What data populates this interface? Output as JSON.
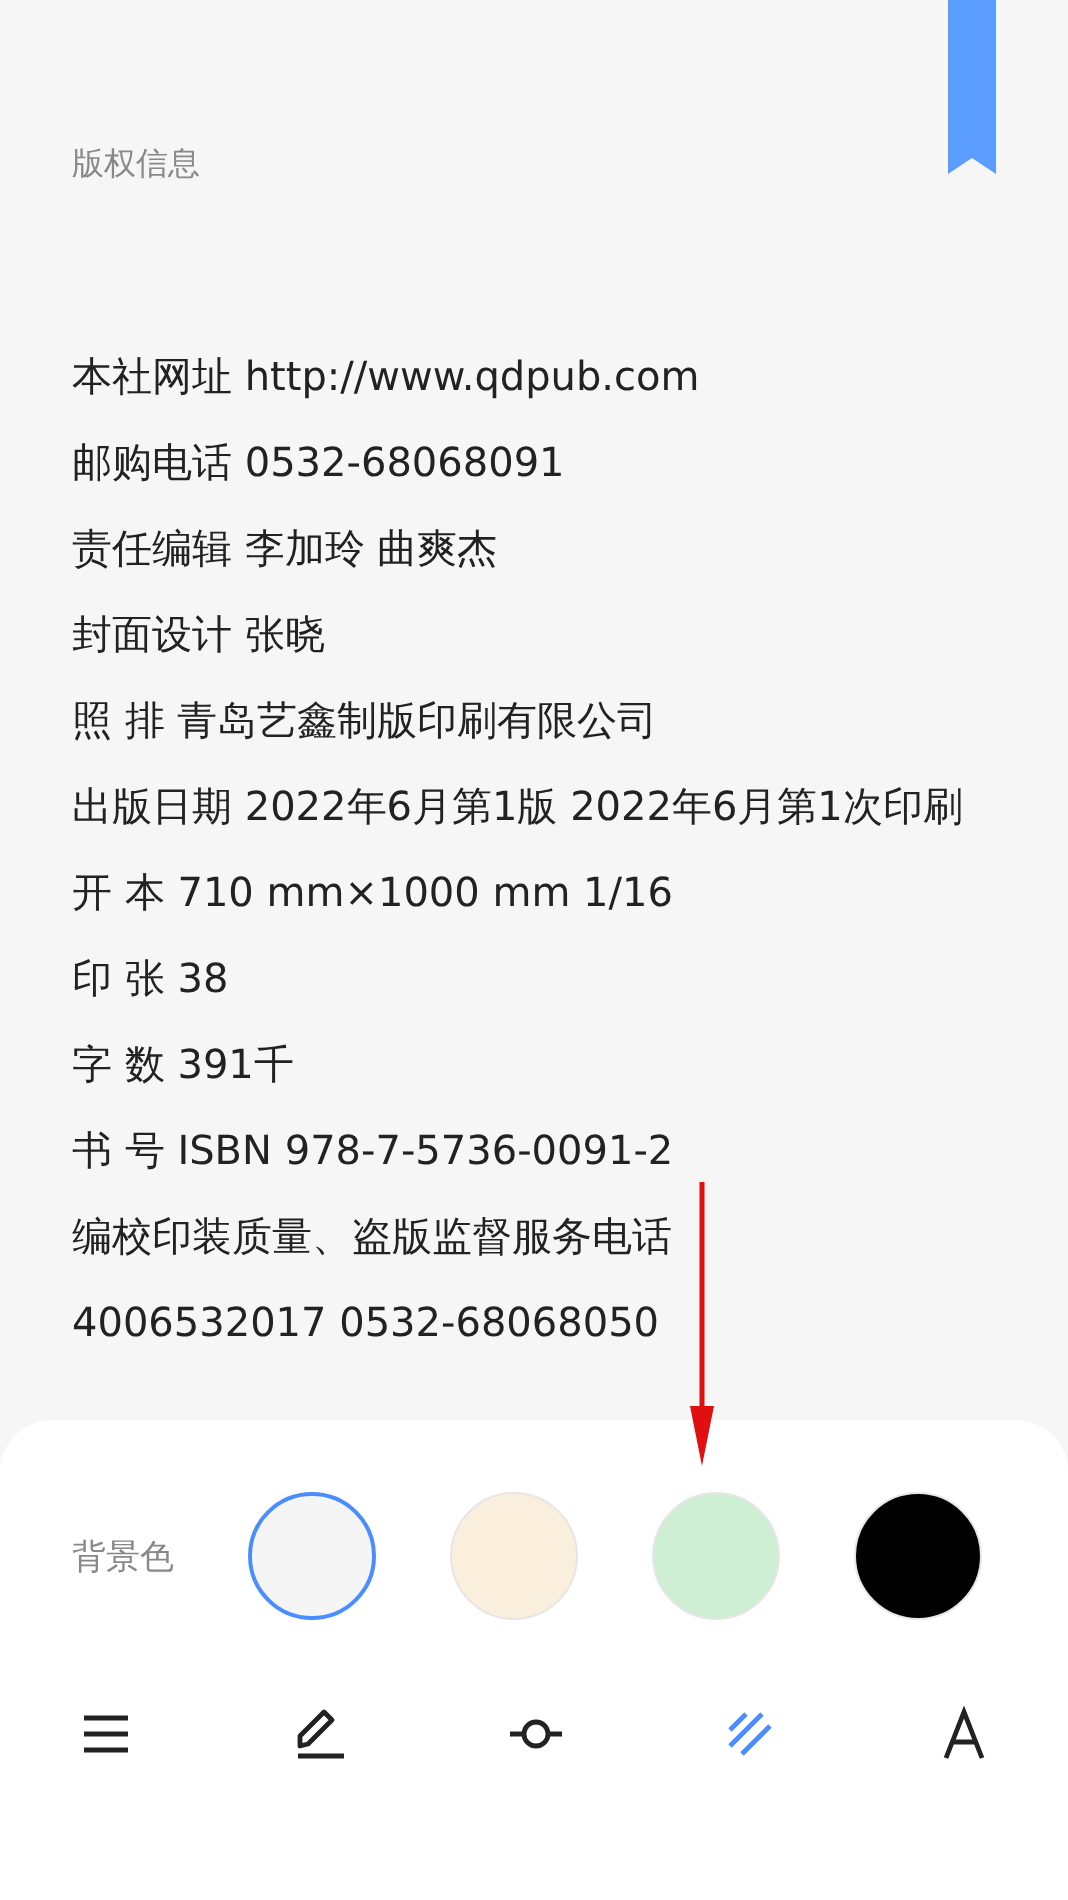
{
  "heading": "版权信息",
  "lines": [
    "本社网址 http://www.qdpub.com",
    "邮购电话 0532-68068091",
    "责任编辑 李加玲 曲爽杰",
    "封面设计 张晓",
    "照 排 青岛艺鑫制版印刷有限公司",
    "出版日期  2022年6月第1版  2022年6月第1次印刷",
    "开 本 710 mm×1000 mm 1/16",
    "印 张 38",
    "字 数 391千",
    "书 号 ISBN 978-7-5736-0091-2",
    "编校印装质量、盗版监督服务电话",
    "4006532017 0532-68068050"
  ],
  "background_panel": {
    "label": "背景色",
    "swatches": [
      {
        "color": "#f5f5f5",
        "selected": true
      },
      {
        "color": "#faefdc",
        "selected": false
      },
      {
        "color": "#cfefd4",
        "selected": false
      },
      {
        "color": "#000000",
        "selected": false
      }
    ]
  },
  "toolbar": [
    {
      "kind": "menu",
      "selected": false
    },
    {
      "kind": "pen",
      "selected": false
    },
    {
      "kind": "progress",
      "selected": false
    },
    {
      "kind": "stripes",
      "selected": true
    },
    {
      "kind": "font",
      "selected": false
    }
  ]
}
